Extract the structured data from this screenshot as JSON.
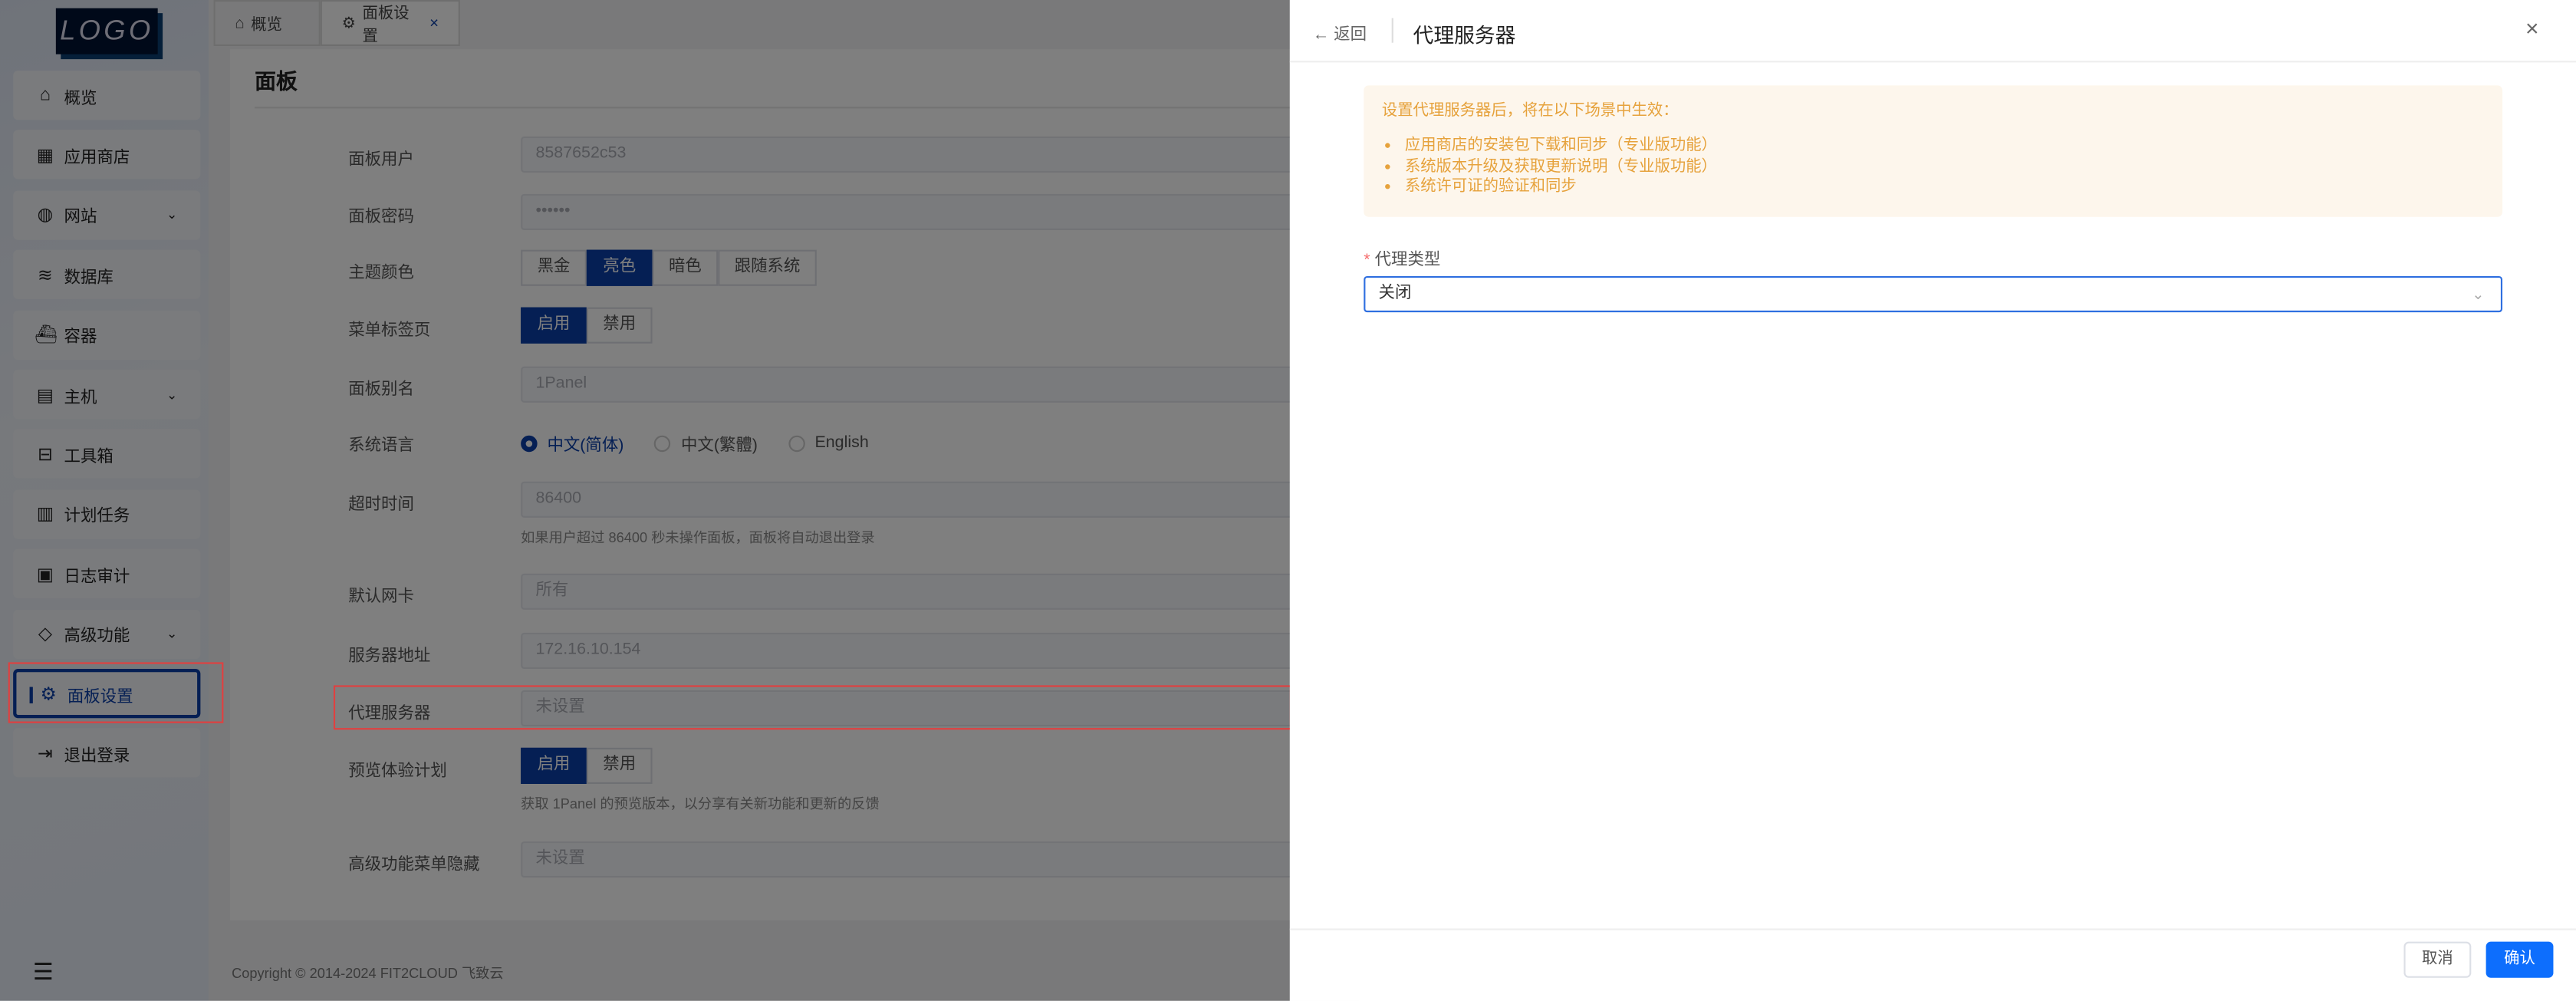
{
  "logo": "LOGO",
  "sidebar": {
    "items": [
      {
        "label": "概览",
        "icon": "home-icon"
      },
      {
        "label": "应用商店",
        "icon": "grid-icon"
      },
      {
        "label": "网站",
        "icon": "globe-icon",
        "expandable": true
      },
      {
        "label": "数据库",
        "icon": "database-icon"
      },
      {
        "label": "容器",
        "icon": "container-icon"
      },
      {
        "label": "主机",
        "icon": "server-icon",
        "expandable": true
      },
      {
        "label": "工具箱",
        "icon": "toolbox-icon"
      },
      {
        "label": "计划任务",
        "icon": "calendar-icon"
      },
      {
        "label": "日志审计",
        "icon": "log-icon"
      },
      {
        "label": "高级功能",
        "icon": "diamond-icon",
        "expandable": true
      },
      {
        "label": "面板设置",
        "icon": "gear-icon",
        "active": true
      },
      {
        "label": "退出登录",
        "icon": "logout-icon"
      }
    ]
  },
  "tabs": [
    {
      "label": "概览"
    },
    {
      "label": "面板设置"
    }
  ],
  "page": {
    "title": "面板",
    "fields": {
      "user": {
        "label": "面板用户",
        "value": "8587652c53"
      },
      "password": {
        "label": "面板密码",
        "value": "••••••"
      },
      "theme": {
        "label": "主题颜色",
        "options": [
          "黑金",
          "亮色",
          "暗色",
          "跟随系统"
        ],
        "selected": "亮色"
      },
      "menu_tabs": {
        "label": "菜单标签页",
        "options": [
          "启用",
          "禁用"
        ],
        "selected": "启用"
      },
      "alias": {
        "label": "面板别名",
        "value": "1Panel"
      },
      "language": {
        "label": "系统语言",
        "options": [
          "中文(简体)",
          "中文(繁體)",
          "English"
        ],
        "selected": "中文(简体)"
      },
      "timeout": {
        "label": "超时时间",
        "value": "86400",
        "help": "如果用户超过 86400 秒未操作面板，面板将自动退出登录"
      },
      "nic": {
        "label": "默认网卡",
        "value": "所有"
      },
      "server_addr": {
        "label": "服务器地址",
        "value": "172.16.10.154"
      },
      "proxy": {
        "label": "代理服务器",
        "value": "未设置"
      },
      "preview": {
        "label": "预览体验计划",
        "options": [
          "启用",
          "禁用"
        ],
        "selected": "启用",
        "help": "获取 1Panel 的预览版本，以分享有关新功能和更新的反馈"
      },
      "hide_menu": {
        "label": "高级功能菜单隐藏",
        "value": "未设置"
      }
    }
  },
  "footer": "Copyright © 2014-2024 FIT2CLOUD 飞致云",
  "drawer": {
    "back": "返回",
    "title": "代理服务器",
    "alert": {
      "title": "设置代理服务器后，将在以下场景中生效：",
      "items": [
        "应用商店的安装包下载和同步（专业版功能）",
        "系统版本升级及获取更新说明（专业版功能）",
        "系统许可证的验证和同步"
      ]
    },
    "proxy_type": {
      "label": "代理类型",
      "value": "关闭"
    },
    "cancel": "取消",
    "confirm": "确认"
  },
  "colors": {
    "primary": "#0b3ea8",
    "confirm": "#0d6efd",
    "warning": "#e6a23c"
  }
}
